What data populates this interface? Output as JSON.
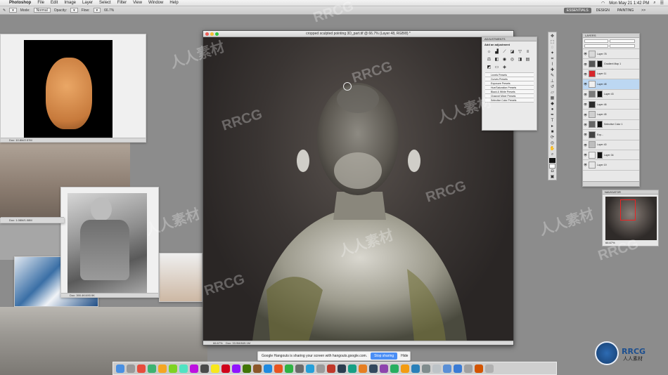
{
  "menubar": {
    "app": "Photoshop",
    "menus": [
      "File",
      "Edit",
      "Image",
      "Layer",
      "Select",
      "Filter",
      "View",
      "Window",
      "Help"
    ],
    "clock": "Mon May 21  1:42 PM"
  },
  "options": {
    "mode_label": "Mode:",
    "mode_value": "Normal",
    "opacity_label": "Opacity:",
    "flow_label": "Flow:",
    "zoom": "66.7%"
  },
  "workspaces": [
    "ESSENTIALS",
    "DESIGN",
    "PAINTING",
    ">>"
  ],
  "document": {
    "title": "cropped sculpted pointing 3D_part.tif @ 66.7% (Layer 48, RGB/8) *",
    "zoom": "66.67%",
    "status": "Doc: 33.9M/849.1M"
  },
  "reference_panels": {
    "mask_status": "Doc: 10.8M/2.57M",
    "boy_status": "Doc: 390.4K/490.9K",
    "left_status": "Doc: 1.08M/1.08M"
  },
  "adjustments": {
    "header": "ADJUSTMENTS",
    "subtitle": "Add an adjustment",
    "presets": [
      "Levels Presets",
      "Curves Presets",
      "Exposure Presets",
      "Hue/Saturation Presets",
      "Black & White Presets",
      "Channel Mixer Presets",
      "Selective Color Presets"
    ]
  },
  "layers": {
    "header": "LAYERS",
    "mode": "Normal",
    "opacity": "100%",
    "rows": [
      {
        "name": "Layer 78",
        "color": "#d9d9d9"
      },
      {
        "name": "Gradient Map 1",
        "color": "#555555"
      },
      {
        "name": "Layer 11",
        "color": "#d7262b"
      },
      {
        "name": "Layer 48",
        "color": "#f0f0f0"
      },
      {
        "name": "Layer 43",
        "color": "#7b7b7b"
      },
      {
        "name": "Layer 46",
        "color": "#2b2b2b"
      },
      {
        "name": "Layer 45",
        "color": "#cfcfcf"
      },
      {
        "name": "Selective Color 1",
        "color": "#666666"
      },
      {
        "name": "Exp...",
        "color": "#444444"
      },
      {
        "name": "Layer 40",
        "color": "#bdbdbd"
      },
      {
        "name": "Layer 34",
        "color": "#eeeeee"
      },
      {
        "name": "Layer 19",
        "color": "#e6e6e6"
      }
    ]
  },
  "navigator": {
    "header": "NAVIGATOR",
    "zoom": "66.67%"
  },
  "share_bar": {
    "message": "Google Hangouts is sharing your screen with hangouts.google.com.",
    "stop": "Stop sharing",
    "hide": "Hide"
  },
  "watermarks": [
    "RRCG",
    "人人素材"
  ],
  "brand": {
    "logo_text": "RRCG",
    "logo_sub": "人人素材"
  }
}
